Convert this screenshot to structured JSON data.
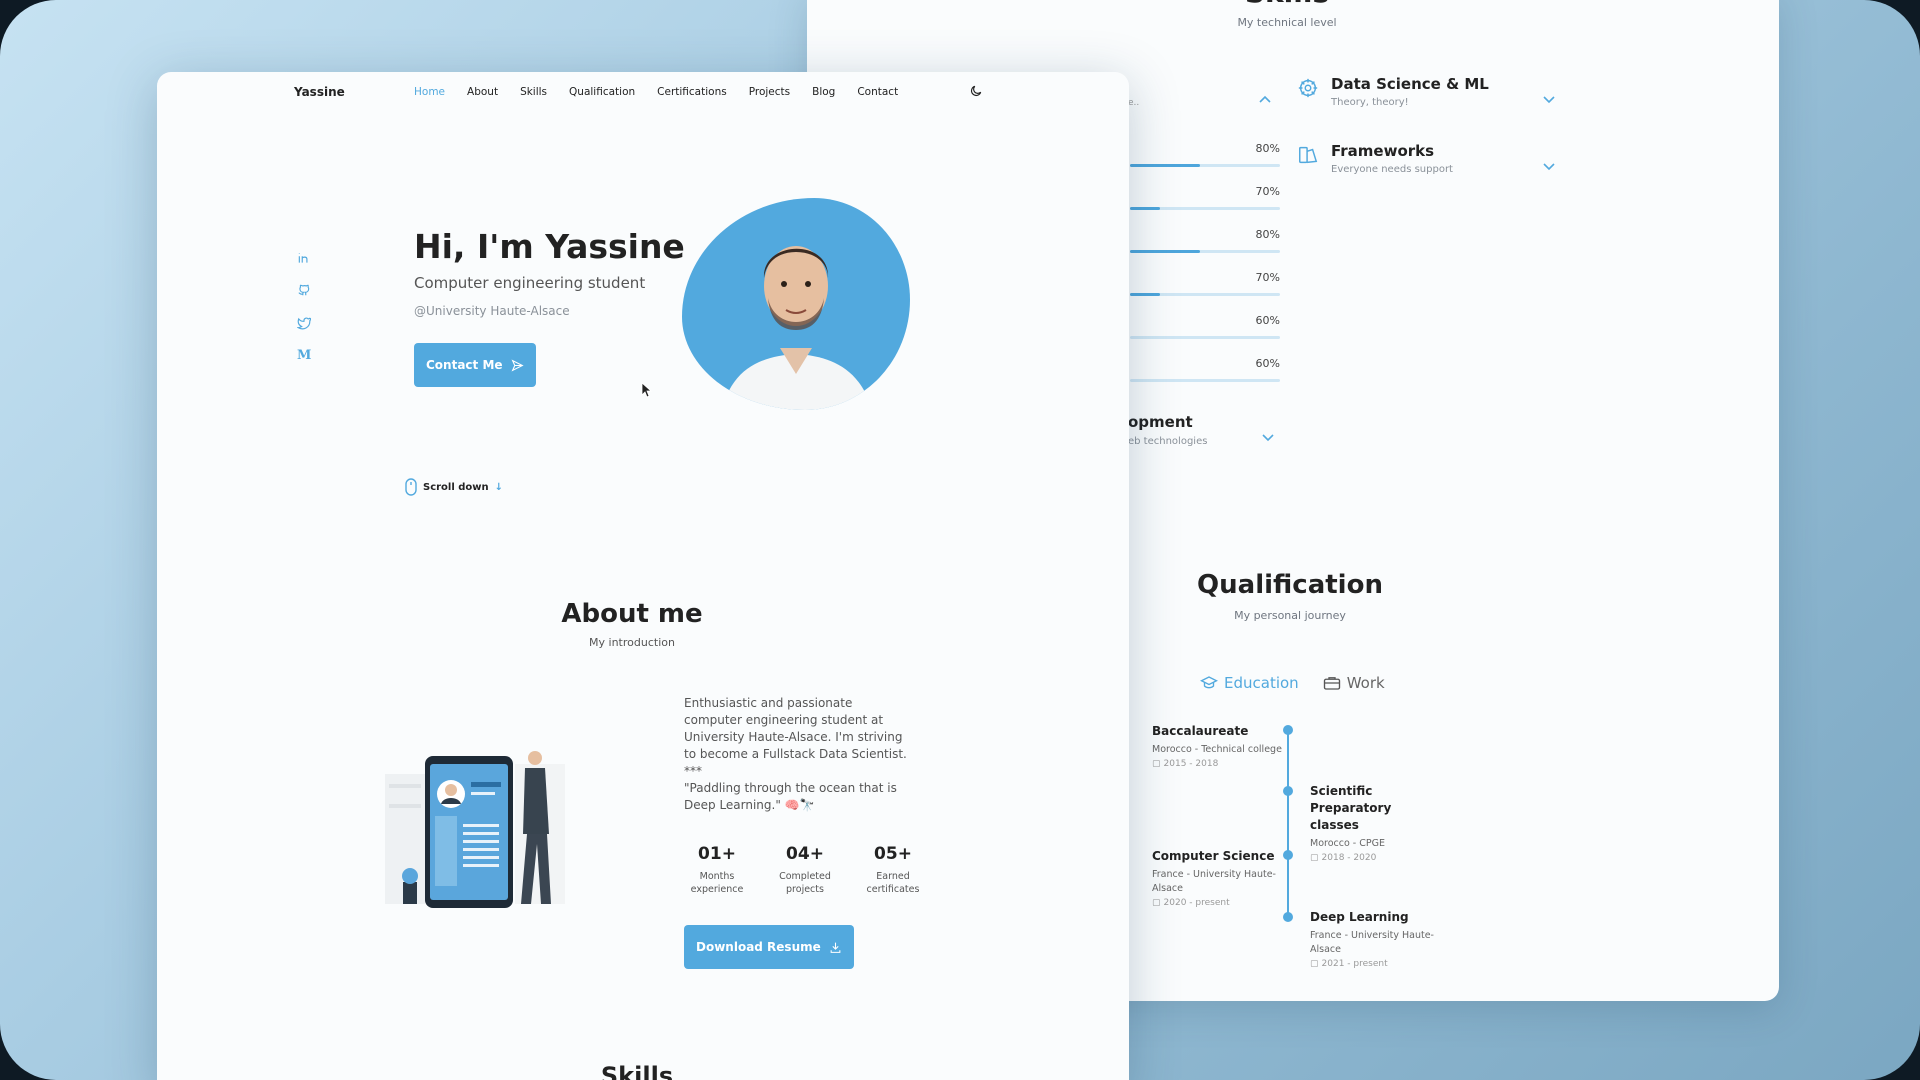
{
  "back": {
    "skills_subtitle": "My technical level",
    "categories": [
      {
        "title": "Data Science & ML",
        "subtitle": "Theory, theory!"
      },
      {
        "title": "Frameworks",
        "subtitle": "Everyone needs support"
      }
    ],
    "cut_category": {
      "title": "opment",
      "subtitle": "eb technologies",
      "subtitle_left": "e.."
    },
    "bars": [
      {
        "percent": "80%",
        "level": 80
      },
      {
        "percent": "70%",
        "level": 70
      },
      {
        "percent": "80%",
        "level": 80
      },
      {
        "percent": "70%",
        "level": 70
      },
      {
        "percent": "60%",
        "level": 60
      },
      {
        "percent": "60%",
        "level": 60
      }
    ],
    "qualification": {
      "title": "Qualification",
      "subtitle": "My personal journey",
      "tabs": [
        {
          "label": "Education",
          "active": true,
          "icon": "graduation-cap-icon"
        },
        {
          "label": "Work",
          "active": false,
          "icon": "briefcase-icon"
        }
      ],
      "timeline": [
        {
          "title": "Baccalaureate",
          "place": "Morocco - Technical college",
          "dates": "2015 - 2018",
          "side": "left"
        },
        {
          "title": "Scientific Preparatory classes",
          "place": "Morocco - CPGE",
          "dates": "2018 - 2020",
          "side": "right"
        },
        {
          "title": "Computer Science",
          "place": "France - University Haute-Alsace",
          "dates": "2020 - present",
          "side": "left"
        },
        {
          "title": "Deep Learning",
          "place": "France - University Haute-Alsace",
          "dates": "2021 - present",
          "side": "right"
        }
      ]
    }
  },
  "front": {
    "logo": "Yassine",
    "nav": [
      "Home",
      "About",
      "Skills",
      "Qualification",
      "Certifications",
      "Projects",
      "Blog",
      "Contact"
    ],
    "social_icons": [
      "linkedin-icon",
      "github-icon",
      "twitter-icon",
      "medium-icon"
    ],
    "hero": {
      "title": "Hi, I'm Yassine",
      "subtitle": "Computer engineering student",
      "university": "@University Haute-Alsace",
      "cta": "Contact Me"
    },
    "scroll_label": "Scroll down",
    "about": {
      "title": "About me",
      "subtitle": "My introduction",
      "description": "Enthusiastic and passionate computer engineering student at University Haute-Alsace. I'm striving to become a Fullstack Data Scientist.",
      "separator": "***",
      "quote": "\"Paddling through the ocean that is Deep Learning.\" 🧠🔭",
      "stats": [
        {
          "number": "01+",
          "label": "Months experience"
        },
        {
          "number": "04+",
          "label": "Completed projects"
        },
        {
          "number": "05+",
          "label": "Earned certificates"
        }
      ],
      "resume_button": "Download Resume"
    },
    "next_section_title": "Skills"
  },
  "colors": {
    "accent": "#52a9de",
    "text": "#222222",
    "muted": "#8a9199",
    "background": "#fafcfd"
  }
}
